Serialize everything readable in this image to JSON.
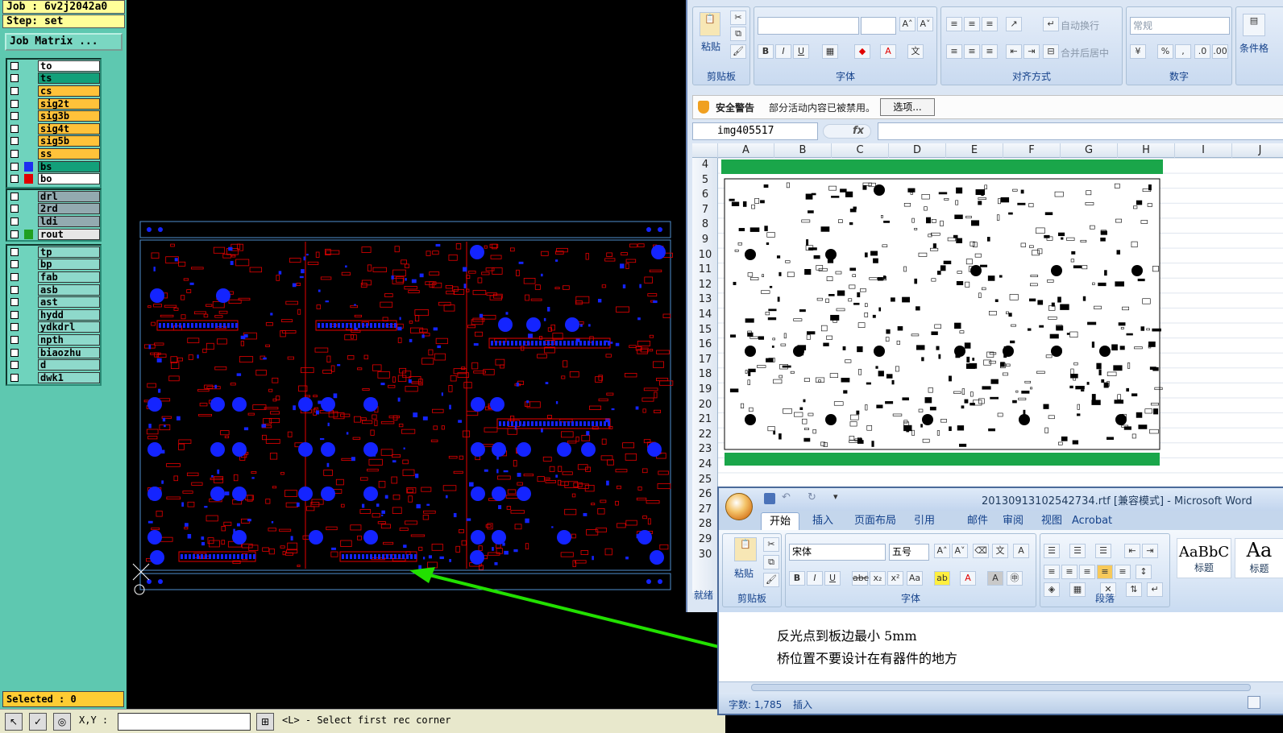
{
  "cam": {
    "job_line": "Job : 6v2j2042a0",
    "step_line": "Step: set",
    "job_matrix_btn": "Job Matrix ...",
    "selected": "Selected : 0",
    "xy_label": "X,Y :",
    "cmd_prompt": "<L> - Select first rec corner",
    "board_layers": [
      {
        "name": "to",
        "fill": "#ffffff",
        "marker": ""
      },
      {
        "name": "ts",
        "fill": "#13a07a",
        "marker": ""
      },
      {
        "name": "cs",
        "fill": "#ffc23a",
        "marker": ""
      },
      {
        "name": "sig2t",
        "fill": "#ffc23a",
        "marker": ""
      },
      {
        "name": "sig3b",
        "fill": "#ffc23a",
        "marker": ""
      },
      {
        "name": "sig4t",
        "fill": "#ffc23a",
        "marker": ""
      },
      {
        "name": "sig5b",
        "fill": "#ffc23a",
        "marker": ""
      },
      {
        "name": "ss",
        "fill": "#ffc23a",
        "marker": ""
      },
      {
        "name": "bs",
        "fill": "#13a07a",
        "marker": "#1d2ff0"
      },
      {
        "name": "bo",
        "fill": "#ffffff",
        "marker": "#e00000",
        "active": true
      }
    ],
    "drill_layers": [
      {
        "name": "drl",
        "fill": "#93aab0",
        "marker": ""
      },
      {
        "name": "2rd",
        "fill": "#93aab0",
        "marker": ""
      },
      {
        "name": "ldi",
        "fill": "#93aab0",
        "marker": ""
      },
      {
        "name": "rout",
        "fill": "#e6e6e6",
        "marker": "#20a020"
      }
    ],
    "doc_layers": [
      {
        "name": "tp",
        "fill": "#8ed9cb",
        "marker": ""
      },
      {
        "name": "bp",
        "fill": "#8ed9cb",
        "marker": ""
      },
      {
        "name": "fab",
        "fill": "#8ed9cb",
        "marker": ""
      },
      {
        "name": "asb",
        "fill": "#8ed9cb",
        "marker": ""
      },
      {
        "name": "ast",
        "fill": "#8ed9cb",
        "marker": ""
      },
      {
        "name": "hydd",
        "fill": "#8ed9cb",
        "marker": ""
      },
      {
        "name": "ydkdrl",
        "fill": "#8ed9cb",
        "marker": ""
      },
      {
        "name": "npth",
        "fill": "#8ed9cb",
        "marker": ""
      },
      {
        "name": "biaozhu",
        "fill": "#8ed9cb",
        "marker": ""
      },
      {
        "name": "d",
        "fill": "#8ed9cb",
        "marker": ""
      },
      {
        "name": "dwk1",
        "fill": "#8ed9cb",
        "marker": ""
      }
    ],
    "colors": {
      "board_outline": "#4f8fd0",
      "copper": "#e60000",
      "pads": "#1424ff",
      "arrow": "#22e000"
    }
  },
  "excel": {
    "clipboard_group": "剪贴板",
    "paste_label": "粘贴",
    "font_group": "字体",
    "align_group": "对齐方式",
    "number_group": "数字",
    "wrap_label": "自动换行",
    "merge_label": "合并后居中",
    "number_format": "常规",
    "cond_format": "条件格",
    "security_title": "安全警告",
    "security_text": "部分活动内容已被禁用。",
    "options_btn": "选项...",
    "name_box": "img405517",
    "fx": "fx",
    "columns": [
      "A",
      "B",
      "C",
      "D",
      "E",
      "F",
      "G",
      "H",
      "I",
      "J"
    ],
    "rows": [
      "4",
      "5",
      "6",
      "7",
      "8",
      "9",
      "10",
      "11",
      "12",
      "13",
      "14",
      "15",
      "16",
      "17",
      "18",
      "19",
      "20",
      "21",
      "22",
      "23",
      "24",
      "25",
      "26",
      "27",
      "28",
      "29",
      "30"
    ],
    "status": "就绪"
  },
  "word": {
    "title": "20130913102542734.rtf [兼容模式] - Microsoft Word",
    "tabs": [
      "开始",
      "插入",
      "页面布局",
      "引用",
      "邮件",
      "审阅",
      "视图",
      "Acrobat"
    ],
    "paste_label": "粘贴",
    "clipboard_group": "剪贴板",
    "font_group": "字体",
    "paragraph_group": "段落",
    "font_name": "宋体",
    "font_size": "五号",
    "style_normal": "AaBbC",
    "style_heading": "Aa",
    "style_label": "标题",
    "style_label2": "标题",
    "doc_lines": [
      "反光点到板边最小 5mm",
      "桥位置不要设计在有器件的地方"
    ],
    "status_words": "字数: 1,785",
    "status_mode": "插入"
  }
}
